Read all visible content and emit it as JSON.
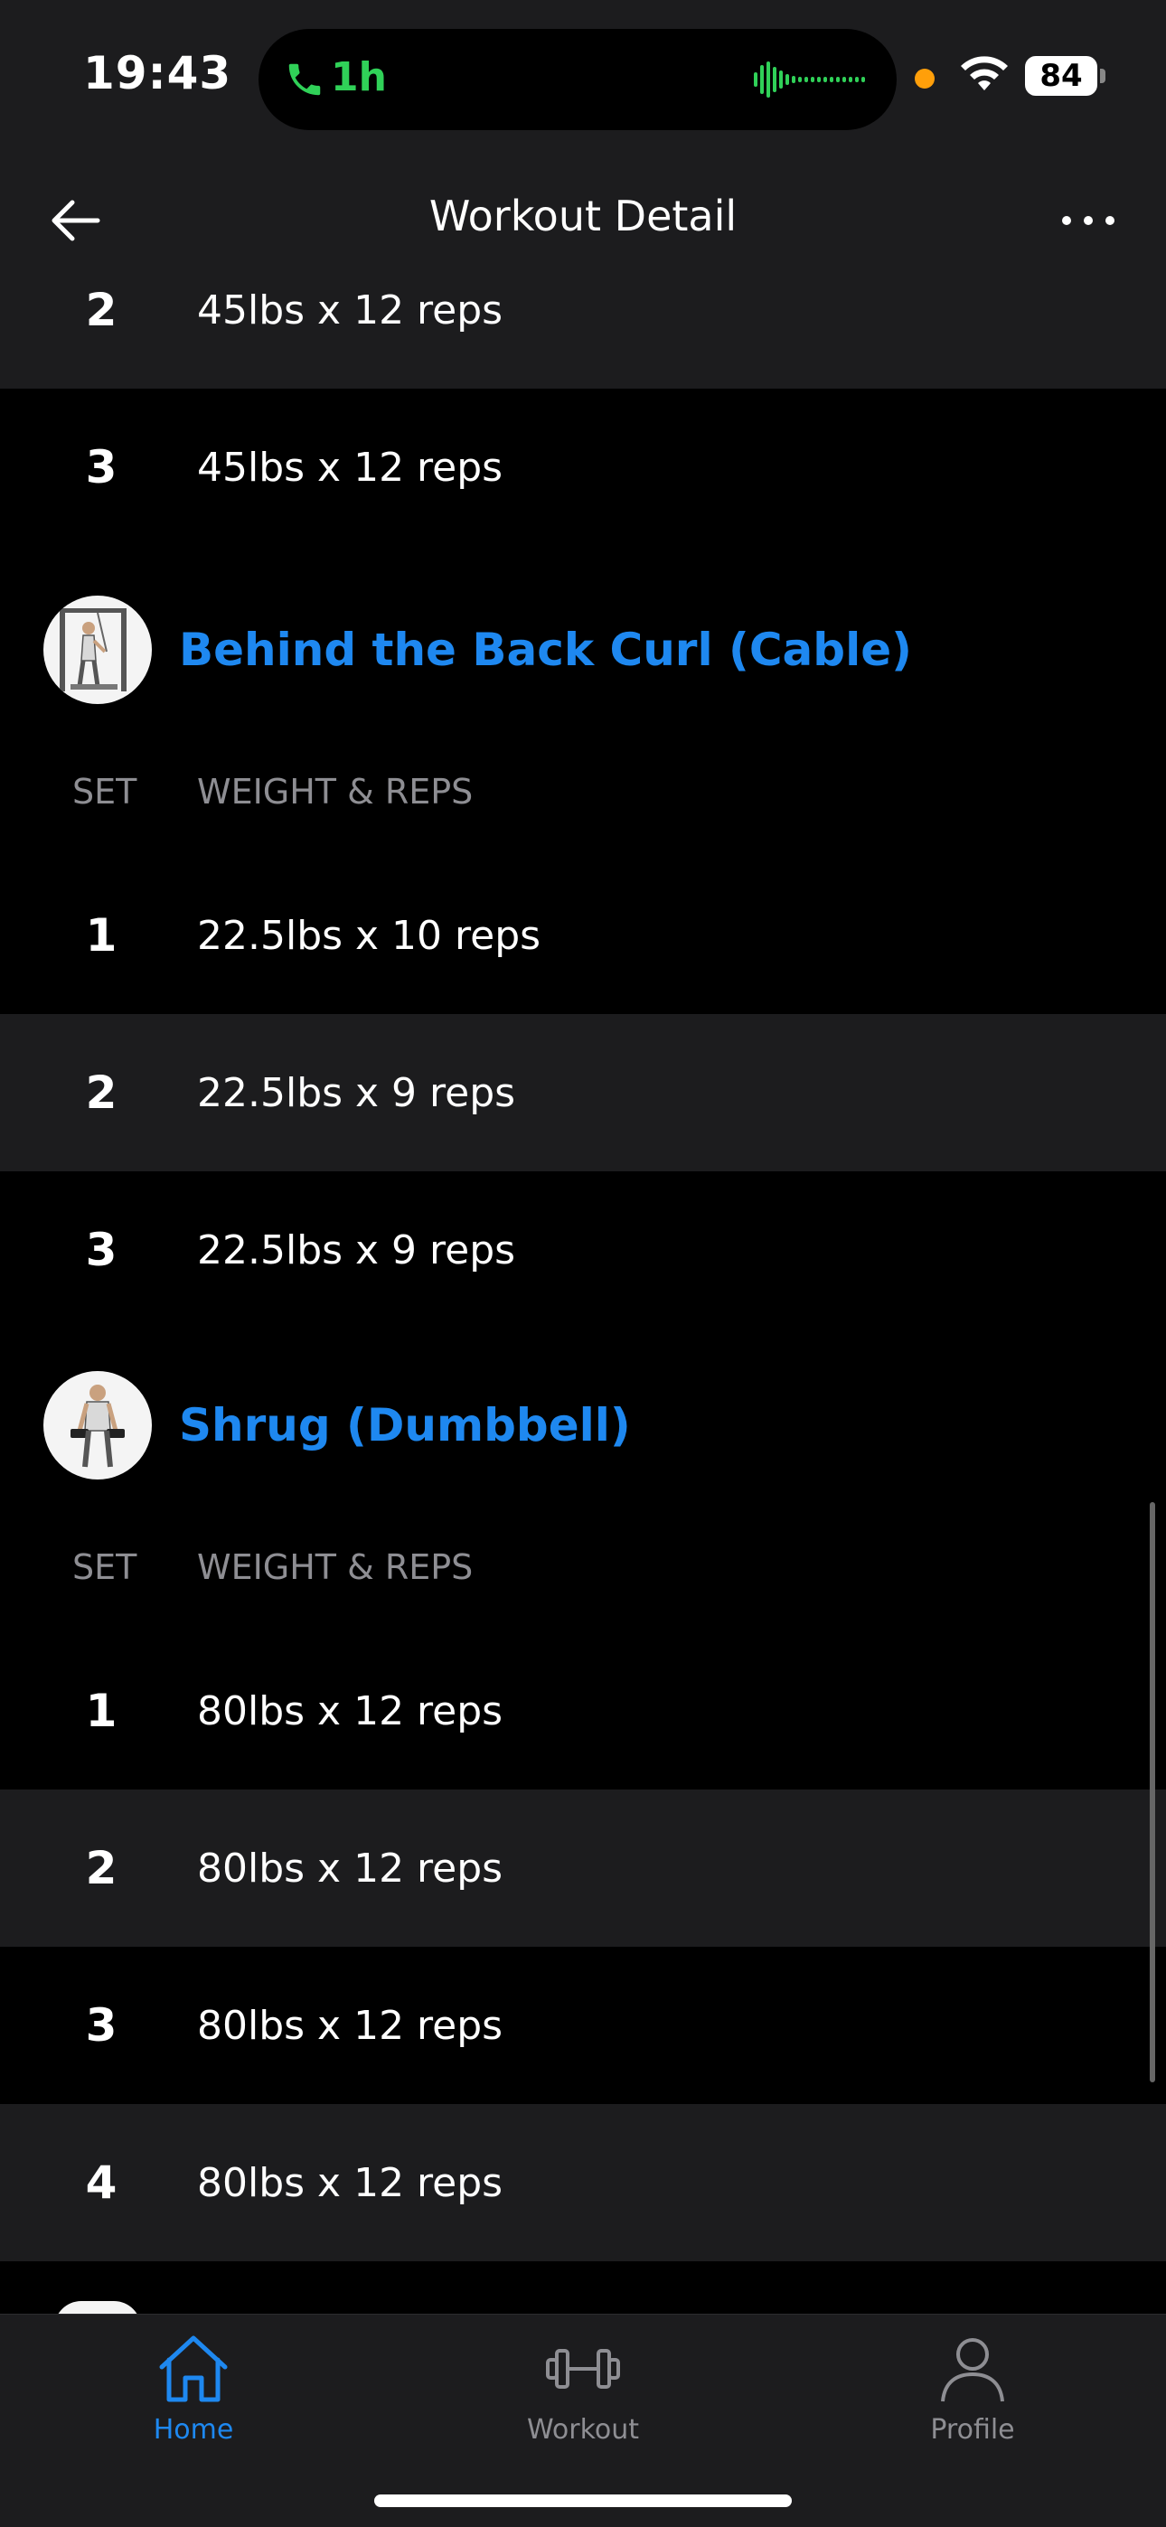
{
  "status_bar": {
    "time": "19:43",
    "call_duration": "1h",
    "battery": "84"
  },
  "nav": {
    "title": "Workout Detail"
  },
  "prev_exercise_sets": [
    {
      "set": "2",
      "value": "45lbs x 12 reps"
    },
    {
      "set": "3",
      "value": "45lbs x 12 reps"
    }
  ],
  "exercises": [
    {
      "name": "Behind the Back Curl (Cable)",
      "col_set": "SET",
      "col_weight": "WEIGHT & REPS",
      "sets": [
        {
          "set": "1",
          "value": "22.5lbs x 10 reps"
        },
        {
          "set": "2",
          "value": "22.5lbs x 9 reps"
        },
        {
          "set": "3",
          "value": "22.5lbs x 9 reps"
        }
      ]
    },
    {
      "name": "Shrug (Dumbbell)",
      "col_set": "SET",
      "col_weight": "WEIGHT & REPS",
      "sets": [
        {
          "set": "1",
          "value": "80lbs x 12 reps"
        },
        {
          "set": "2",
          "value": "80lbs x 12 reps"
        },
        {
          "set": "3",
          "value": "80lbs x 12 reps"
        },
        {
          "set": "4",
          "value": "80lbs x 12 reps"
        }
      ]
    }
  ],
  "tabs": [
    {
      "label": "Home",
      "icon": "home-icon",
      "active": true
    },
    {
      "label": "Workout",
      "icon": "dumbbell-icon",
      "active": false
    },
    {
      "label": "Profile",
      "icon": "person-icon",
      "active": false
    }
  ],
  "colors": {
    "accent": "#1e88f0",
    "background": "#000000",
    "surface": "#1c1c1e",
    "call_green": "#30d158"
  }
}
